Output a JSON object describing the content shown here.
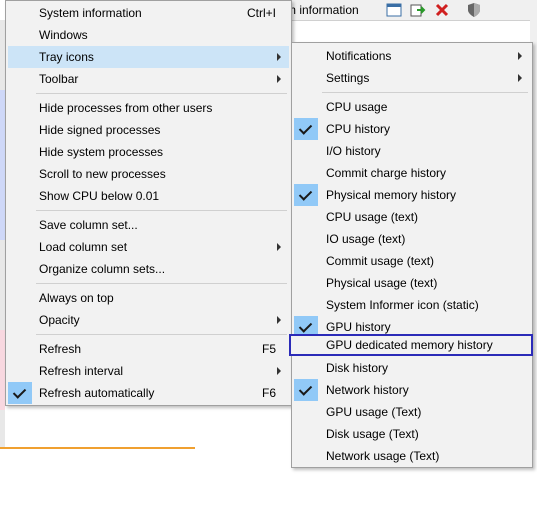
{
  "toolbar": {
    "title_fragment": "m information"
  },
  "main_menu": {
    "items": [
      {
        "label": "System information",
        "shortcut": "Ctrl+I"
      },
      {
        "label": "Windows"
      },
      {
        "label": "Tray icons"
      },
      {
        "label": "Toolbar"
      },
      {
        "label": "Hide processes from other users"
      },
      {
        "label": "Hide signed processes"
      },
      {
        "label": "Hide system processes"
      },
      {
        "label": "Scroll to new processes"
      },
      {
        "label": "Show CPU below 0.01"
      },
      {
        "label": "Save column set..."
      },
      {
        "label": "Load column set"
      },
      {
        "label": "Organize column sets..."
      },
      {
        "label": "Always on top"
      },
      {
        "label": "Opacity"
      },
      {
        "label": "Refresh",
        "shortcut": "F5"
      },
      {
        "label": "Refresh interval"
      },
      {
        "label": "Refresh automatically",
        "shortcut": "F6",
        "checked": true
      }
    ]
  },
  "sub_menu": {
    "items": [
      {
        "label": "Notifications"
      },
      {
        "label": "Settings"
      },
      {
        "label": "CPU usage"
      },
      {
        "label": "CPU history",
        "checked": true
      },
      {
        "label": "I/O history"
      },
      {
        "label": "Commit charge history"
      },
      {
        "label": "Physical memory history",
        "checked": true
      },
      {
        "label": "CPU usage (text)"
      },
      {
        "label": "IO usage (text)"
      },
      {
        "label": "Commit usage (text)"
      },
      {
        "label": "Physical usage (text)"
      },
      {
        "label": "System Informer icon (static)"
      },
      {
        "label": "GPU history",
        "checked": true
      },
      {
        "label": "GPU dedicated memory history"
      },
      {
        "label": "Disk history"
      },
      {
        "label": "Network history",
        "checked": true
      },
      {
        "label": "GPU usage (Text)"
      },
      {
        "label": "Disk usage (Text)"
      },
      {
        "label": "Network usage (Text)"
      }
    ]
  },
  "colors": {
    "menu_bg": "#f2f2f2",
    "highlight": "#cce4f7",
    "check_bg": "#91c9f7",
    "focus_outline": "#2b2bb8"
  }
}
